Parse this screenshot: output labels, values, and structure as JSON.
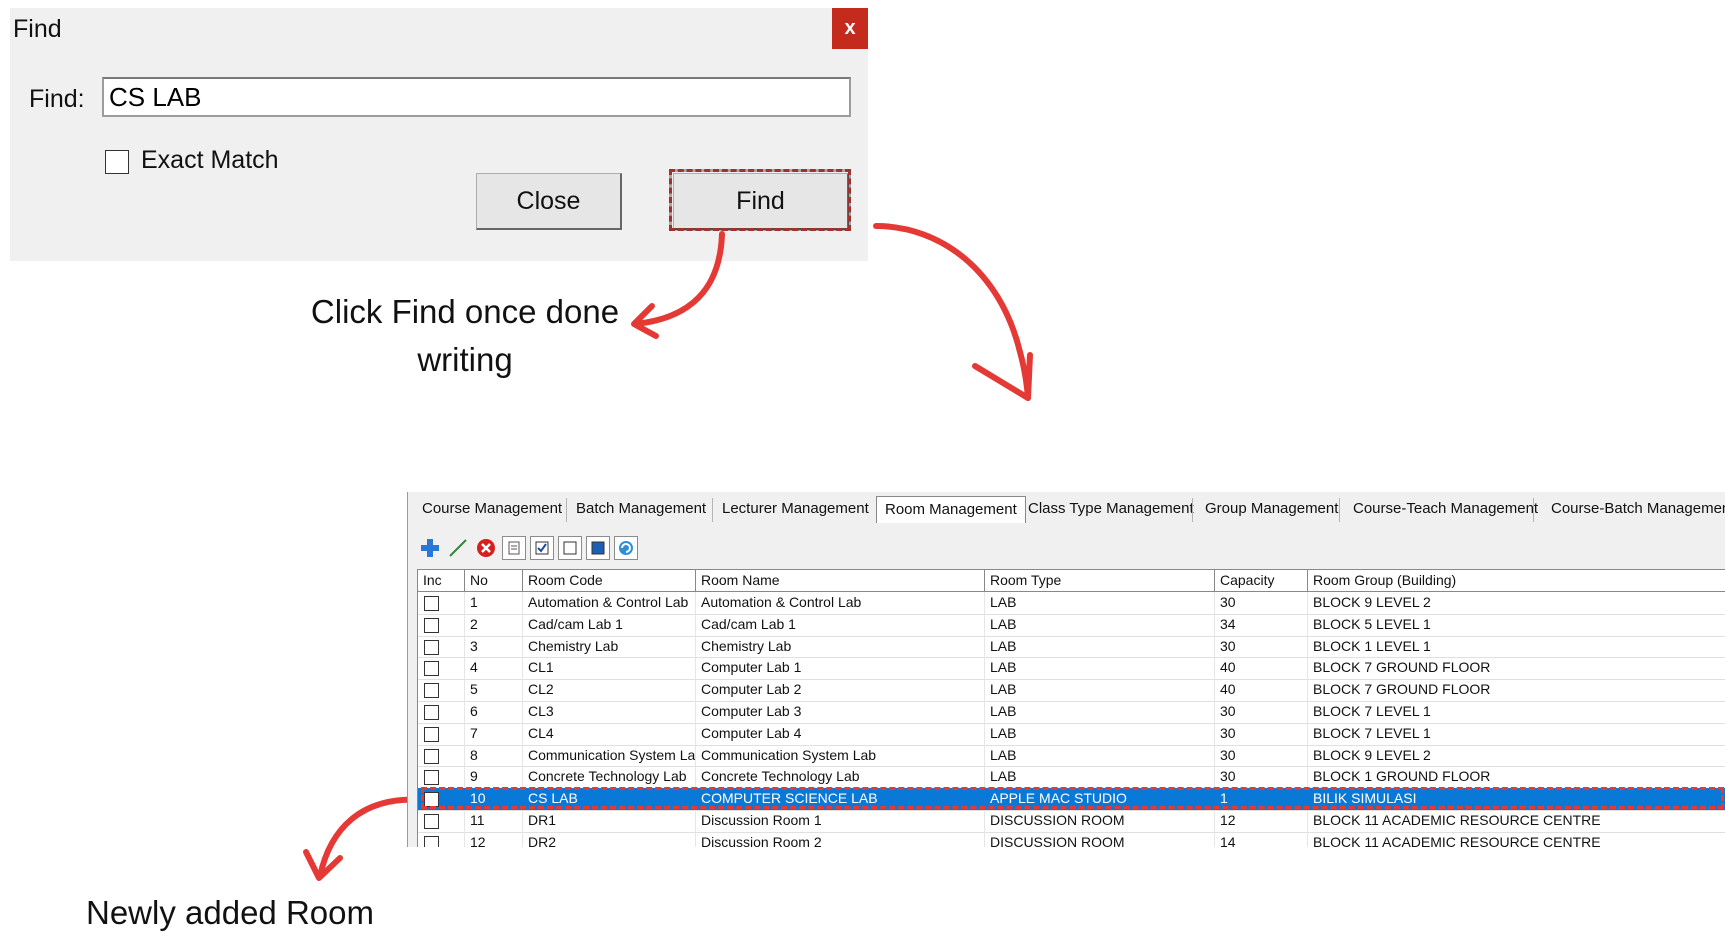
{
  "dialog": {
    "title": "Find",
    "close_glyph": "x",
    "find_label": "Find:",
    "find_value": "CS LAB",
    "exact_match_label": "Exact Match",
    "exact_match_checked": false,
    "close_button": "Close",
    "find_button": "Find"
  },
  "annotations": {
    "click_find_line1": "Click Find once done",
    "click_find_line2": "writing",
    "newly_added": "Newly added Room",
    "accent_color": "#e53935"
  },
  "tabs": [
    {
      "label": "Course Management"
    },
    {
      "label": "Batch Management"
    },
    {
      "label": "Lecturer Management"
    },
    {
      "label": "Room Management",
      "active": true
    },
    {
      "label": "Class Type Management"
    },
    {
      "label": "Group Management"
    },
    {
      "label": "Course-Teach Management"
    },
    {
      "label": "Course-Batch Management"
    }
  ],
  "toolbar": [
    {
      "icon": "add-icon"
    },
    {
      "icon": "edit-icon"
    },
    {
      "icon": "delete-icon"
    },
    {
      "icon": "print-icon"
    },
    {
      "icon": "check-all-icon"
    },
    {
      "icon": "uncheck-all-icon"
    },
    {
      "icon": "view-icon"
    },
    {
      "icon": "refresh-icon"
    }
  ],
  "table": {
    "headers": [
      "Inc",
      "No",
      "Room Code",
      "Room Name",
      "Room Type",
      "Capacity",
      "Room Group (Building)"
    ],
    "rows": [
      [
        "",
        "1",
        "Automation & Control Lab",
        "Automation & Control Lab",
        "LAB",
        "30",
        "BLOCK 9 LEVEL 2"
      ],
      [
        "",
        "2",
        "Cad/cam Lab 1",
        "Cad/cam Lab 1",
        "LAB",
        "34",
        "BLOCK 5 LEVEL 1"
      ],
      [
        "",
        "3",
        "Chemistry Lab",
        "Chemistry Lab",
        "LAB",
        "30",
        "BLOCK 1 LEVEL 1"
      ],
      [
        "",
        "4",
        "CL1",
        "Computer Lab 1",
        "LAB",
        "40",
        "BLOCK 7 GROUND FLOOR"
      ],
      [
        "",
        "5",
        "CL2",
        "Computer Lab 2",
        "LAB",
        "40",
        "BLOCK 7 GROUND FLOOR"
      ],
      [
        "",
        "6",
        "CL3",
        "Computer Lab 3",
        "LAB",
        "30",
        "BLOCK 7 LEVEL 1"
      ],
      [
        "",
        "7",
        "CL4",
        "Computer Lab 4",
        "LAB",
        "30",
        "BLOCK 7 LEVEL 1"
      ],
      [
        "",
        "8",
        "Communication System Lab",
        "Communication System Lab",
        "LAB",
        "30",
        "BLOCK 9 LEVEL 2"
      ],
      [
        "",
        "9",
        "Concrete Technology Lab",
        "Concrete Technology Lab",
        "LAB",
        "30",
        "BLOCK 1 GROUND FLOOR"
      ],
      [
        "",
        "10",
        "CS LAB",
        "COMPUTER SCIENCE LAB",
        "APPLE MAC STUDIO",
        "1",
        "BILIK SIMULASI"
      ],
      [
        "",
        "11",
        "DR1",
        "Discussion Room 1",
        "DISCUSSION ROOM",
        "12",
        "BLOCK 11 ACADEMIC RESOURCE CENTRE"
      ],
      [
        "",
        "12",
        "DR2",
        "Discussion Room 2",
        "DISCUSSION ROOM",
        "14",
        "BLOCK 11 ACADEMIC RESOURCE CENTRE"
      ]
    ],
    "selected_row": 9,
    "selection_color": "#0a78d7"
  }
}
